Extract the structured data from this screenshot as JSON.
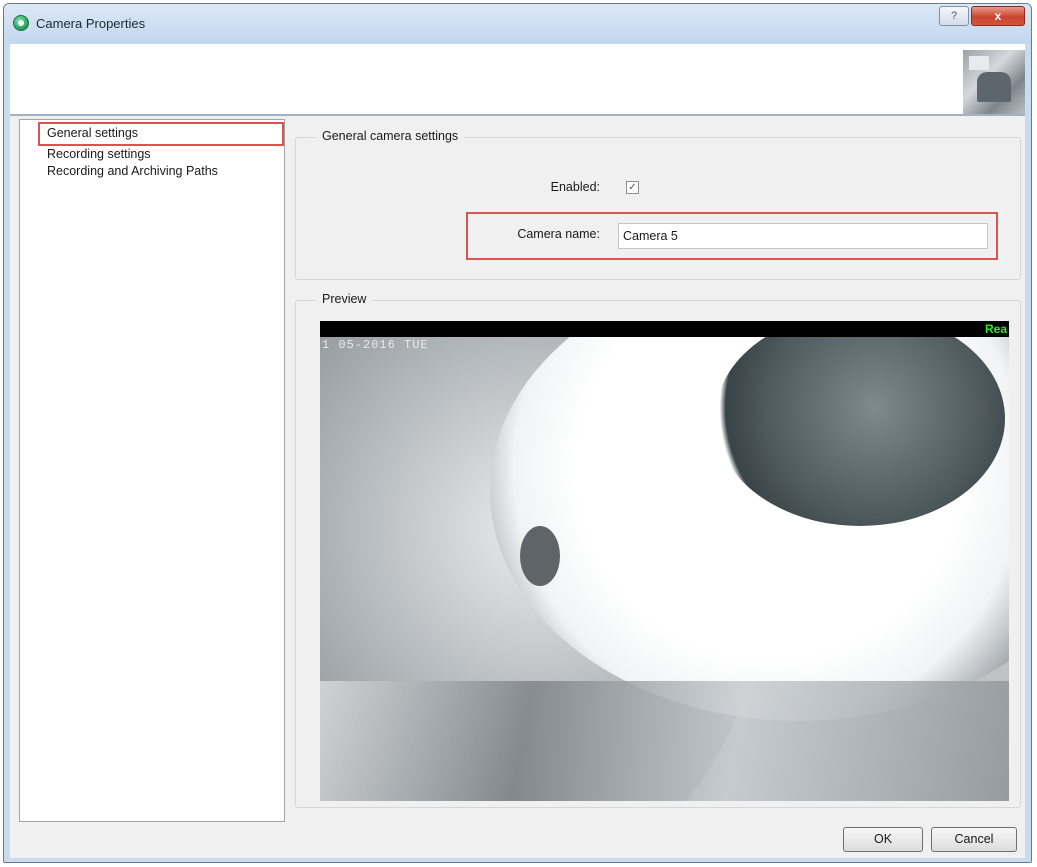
{
  "window": {
    "title": "Camera Properties",
    "help_glyph": "?",
    "close_glyph": "x"
  },
  "nav": {
    "items": [
      {
        "label": "General settings",
        "selected": true
      },
      {
        "label": "Recording settings",
        "selected": false
      },
      {
        "label": "Recording and Archiving Paths",
        "selected": false
      }
    ]
  },
  "general": {
    "group_title": "General camera settings",
    "enabled_label": "Enabled:",
    "enabled_checked": true,
    "checkbox_glyph": "✓",
    "camera_name_label": "Camera name:",
    "camera_name_value": "Camera 5"
  },
  "preview": {
    "title": "Preview",
    "osd_datetime": "1 05-2016 TUE",
    "status_text": "Rea"
  },
  "buttons": {
    "ok": "OK",
    "cancel": "Cancel"
  },
  "colors": {
    "highlight": "#d9534f",
    "titlebar": "#c9dcef",
    "close": "#c9452f",
    "rec_text": "#2ee82e"
  },
  "icons": [
    "camera-app-icon",
    "help-icon",
    "close-icon",
    "check-icon"
  ]
}
